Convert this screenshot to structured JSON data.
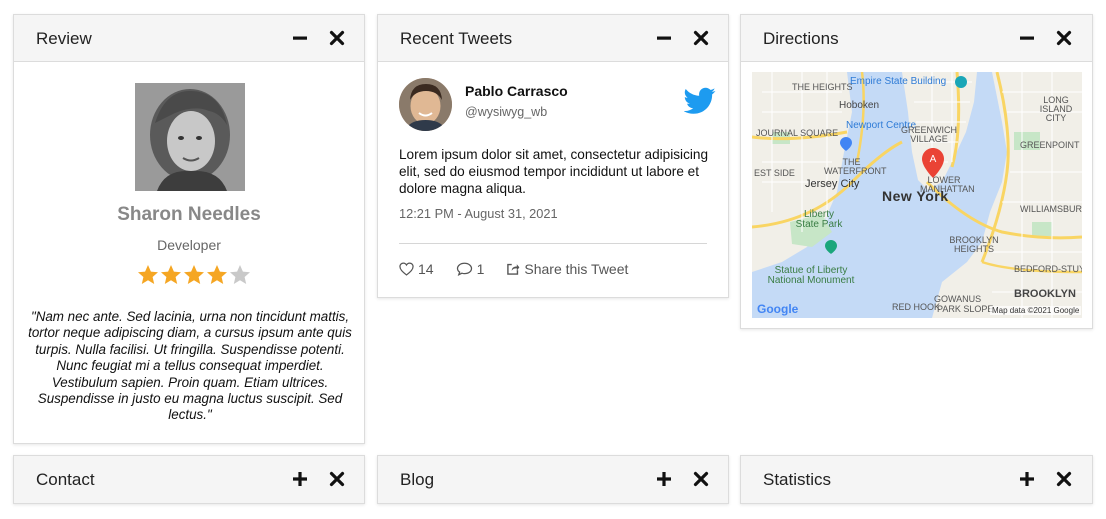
{
  "panels": {
    "review": {
      "title": "Review",
      "name": "Sharon Needles",
      "role": "Developer",
      "rating": 4,
      "rating_max": 5,
      "quote": "\"Nam nec ante. Sed lacinia, urna non tincidunt mattis, tortor neque adipiscing diam, a cursus ipsum ante quis turpis. Nulla facilisi. Ut fringilla. Suspendisse potenti. Nunc feugiat mi a tellus consequat imperdiet. Vestibulum sapien. Proin quam. Etiam ultrices. Suspendisse in justo eu magna luctus suscipit. Sed lectus.\""
    },
    "tweets": {
      "title": "Recent Tweets",
      "author": "Pablo Carrasco",
      "handle": "@wysiwyg_wb",
      "text": "Lorem ipsum dolor sit amet, consectetur adipisicing elit, sed do eiusmod tempor incididunt ut labore et dolore magna aliqua.",
      "time": "12:21 PM - August 31, 2021",
      "likes": "14",
      "replies": "1",
      "share_label": "Share this Tweet"
    },
    "directions": {
      "title": "Directions",
      "map_labels": {
        "esb": "Empire State Building",
        "heights": "THE HEIGHTS",
        "hoboken": "Hoboken",
        "long_island": "LONG ISLAND CITY",
        "newport": "Newport Centre",
        "greenwich": "GREENWICH VILLAGE",
        "journal": "JOURNAL SQUARE",
        "greenpoint": "GREENPOINT",
        "waterfront": "THE WATERFRONT",
        "manhattan": "LOWER MANHATTAN",
        "east_side": "EST SIDE",
        "jersey_city": "Jersey City",
        "new_york": "New York",
        "williamsburg": "WILLIAMSBURG",
        "liberty": "Liberty State Park",
        "brooklyn_heights": "BROOKLYN HEIGHTS",
        "statue": "Statue of Liberty National Monument",
        "bedford": "BEDFORD-STUYVES",
        "brooklyn": "BROOKLYN",
        "red_hook": "RED HOOK",
        "gowanus": "GOWANUS",
        "park_slope": "PARK SLOPE",
        "google": "Google",
        "map_data": "Map data ©2021 Google",
        "marker": "A"
      }
    },
    "contact": {
      "title": "Contact"
    },
    "blog": {
      "title": "Blog"
    },
    "statistics": {
      "title": "Statistics"
    }
  },
  "colors": {
    "star_filled": "#f5a623",
    "star_empty": "#c9c9c9",
    "twitter_blue": "#1d9bf0",
    "header_bg": "#f5f5f5"
  },
  "icons": {
    "minimize": "minus-icon",
    "expand": "plus-icon",
    "close": "close-icon",
    "like": "heart-icon",
    "reply": "comment-icon",
    "share": "share-icon",
    "brand": "twitter-bird-icon",
    "map_marker": "map-pin-icon"
  }
}
